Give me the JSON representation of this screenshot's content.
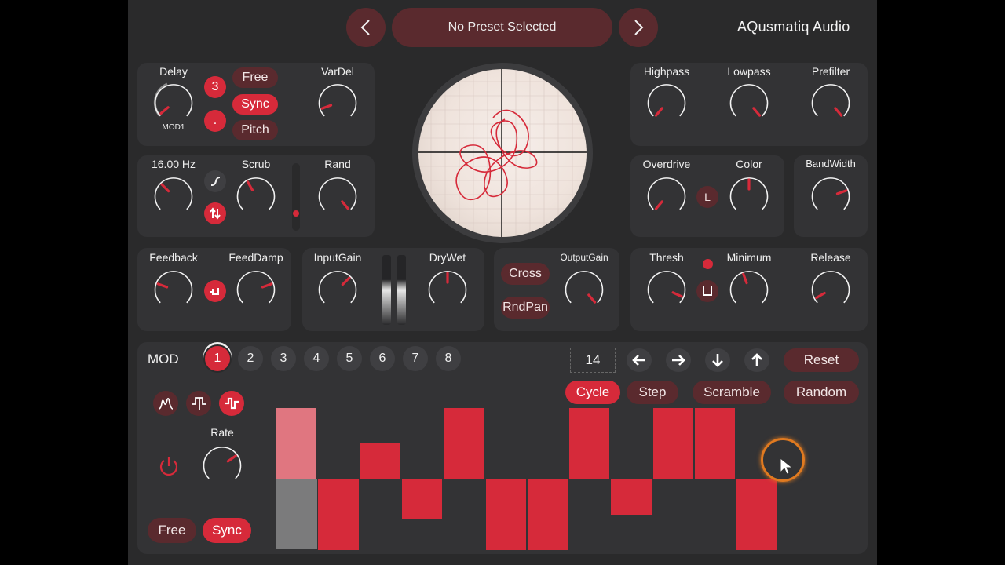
{
  "header": {
    "preset_name": "No Preset Selected",
    "brand": "AQusmatiq Audio"
  },
  "delay_panel": {
    "delay_label": "Delay",
    "mod_label": "MOD1",
    "division_value": "3",
    "dot_label": ".",
    "free_label": "Free",
    "sync_label": "Sync",
    "pitch_label": "Pitch",
    "vardel_label": "VarDel"
  },
  "lfo_panel": {
    "rate_value": "16.00 Hz",
    "scrub_label": "Scrub",
    "rand_label": "Rand"
  },
  "filter_panel": {
    "highpass_label": "Highpass",
    "lowpass_label": "Lowpass",
    "prefilter_label": "Prefilter"
  },
  "drive_panel": {
    "overdrive_label": "Overdrive",
    "color_label": "Color",
    "link_label": "L",
    "bandwidth_label": "BandWidth"
  },
  "feedback_panel": {
    "feedback_label": "Feedback",
    "feeddamp_label": "FeedDamp"
  },
  "gain_panel": {
    "inputgain_label": "InputGain",
    "drywet_label": "DryWet"
  },
  "output_panel": {
    "cross_label": "Cross",
    "rndpan_label": "RndPan",
    "outputgain_label": "OutputGain"
  },
  "dynamics_panel": {
    "thresh_label": "Thresh",
    "minimum_label": "Minimum",
    "release_label": "Release"
  },
  "mod": {
    "title": "MOD",
    "slots": [
      "1",
      "2",
      "3",
      "4",
      "5",
      "6",
      "7",
      "8"
    ],
    "active_slot": "1",
    "step_count": "14",
    "reset_label": "Reset",
    "cycle_label": "Cycle",
    "step_label": "Step",
    "scramble_label": "Scramble",
    "random_label": "Random",
    "rate_label": "Rate",
    "free_label": "Free",
    "sync_label": "Sync",
    "step_values": [
      1.0,
      -1.0,
      0.5,
      -0.55,
      1.0,
      -1.0,
      -1.0,
      1.0,
      -0.5,
      1.0,
      1.0,
      -1.0,
      0.0,
      0.0
    ],
    "active_step_index": 0
  },
  "colors": {
    "accent": "#d62a3a",
    "accent_dark": "#5a2a2e",
    "panel": "#333335",
    "background": "#2a2a2b"
  }
}
